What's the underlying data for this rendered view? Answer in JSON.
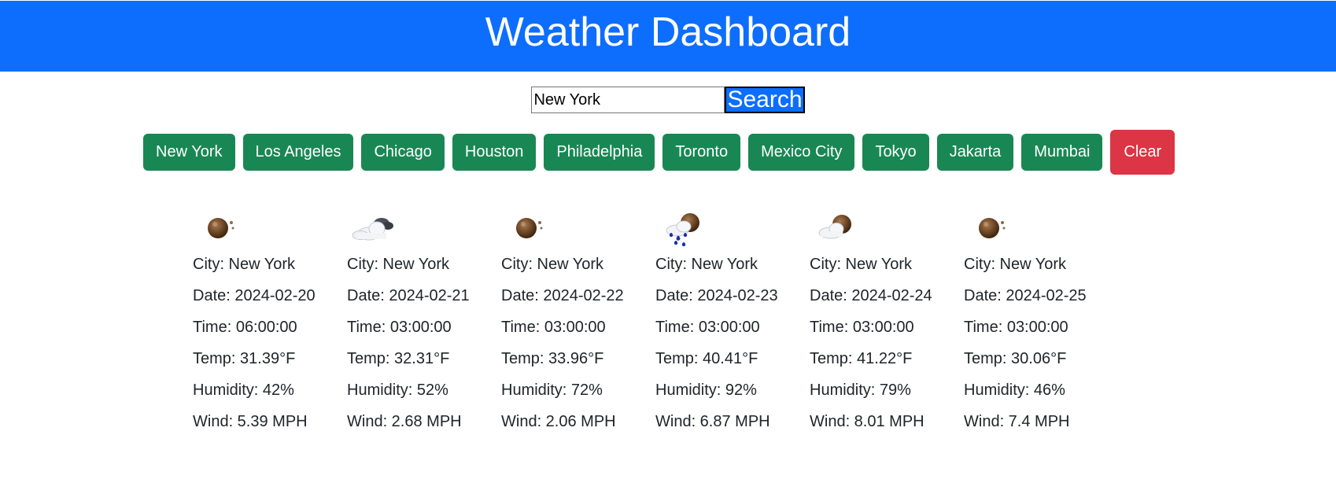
{
  "header": {
    "title": "Weather Dashboard"
  },
  "search": {
    "value": "New York",
    "button_label": "Search"
  },
  "cities": [
    "New York",
    "Los Angeles",
    "Chicago",
    "Houston",
    "Philadelphia",
    "Toronto",
    "Mexico City",
    "Tokyo",
    "Jakarta",
    "Mumbai"
  ],
  "clear_label": "Clear",
  "colors": {
    "header": "#0d6efd",
    "city_button": "#198754",
    "clear_button": "#dc3545"
  },
  "forecast": [
    {
      "icon": "clear-night-icon",
      "city": "City: New York",
      "date": "Date: 2024-02-20",
      "time": "Time: 06:00:00",
      "temp": "Temp: 31.39°F",
      "humidity": "Humidity: 42%",
      "wind": "Wind: 5.39 MPH"
    },
    {
      "icon": "cloudy-icon",
      "city": "City: New York",
      "date": "Date: 2024-02-21",
      "time": "Time: 03:00:00",
      "temp": "Temp: 32.31°F",
      "humidity": "Humidity: 52%",
      "wind": "Wind: 2.68 MPH"
    },
    {
      "icon": "clear-night-icon",
      "city": "City: New York",
      "date": "Date: 2024-02-22",
      "time": "Time: 03:00:00",
      "temp": "Temp: 33.96°F",
      "humidity": "Humidity: 72%",
      "wind": "Wind: 2.06 MPH"
    },
    {
      "icon": "rain-night-icon",
      "city": "City: New York",
      "date": "Date: 2024-02-23",
      "time": "Time: 03:00:00",
      "temp": "Temp: 40.41°F",
      "humidity": "Humidity: 92%",
      "wind": "Wind: 6.87 MPH"
    },
    {
      "icon": "partly-cloudy-night-icon",
      "city": "City: New York",
      "date": "Date: 2024-02-24",
      "time": "Time: 03:00:00",
      "temp": "Temp: 41.22°F",
      "humidity": "Humidity: 79%",
      "wind": "Wind: 8.01 MPH"
    },
    {
      "icon": "clear-night-icon",
      "city": "City: New York",
      "date": "Date: 2024-02-25",
      "time": "Time: 03:00:00",
      "temp": "Temp: 30.06°F",
      "humidity": "Humidity: 46%",
      "wind": "Wind: 7.4 MPH"
    }
  ]
}
